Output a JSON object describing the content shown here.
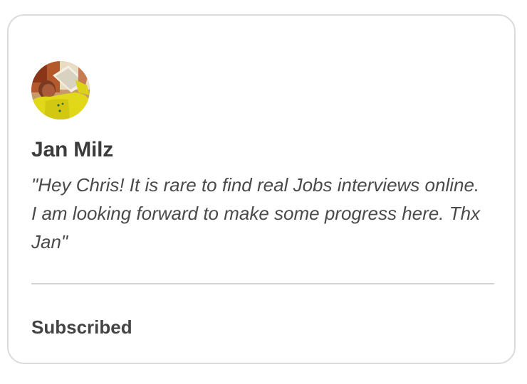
{
  "testimonial": {
    "avatar_icon": "person-photo-avatar",
    "name": "Jan Milz",
    "quote": "\"Hey Chris! It is rare to find real Jobs interviews online. I am looking forward to make some progress here. Thx Jan\"",
    "status": "Subscribed"
  },
  "colors": {
    "border": "#dcdcdc",
    "name_text": "#3b3b3b",
    "quote_text": "#4a4a4a",
    "divider": "#d3d3d3",
    "avatar_shirt": "#e0d818"
  }
}
